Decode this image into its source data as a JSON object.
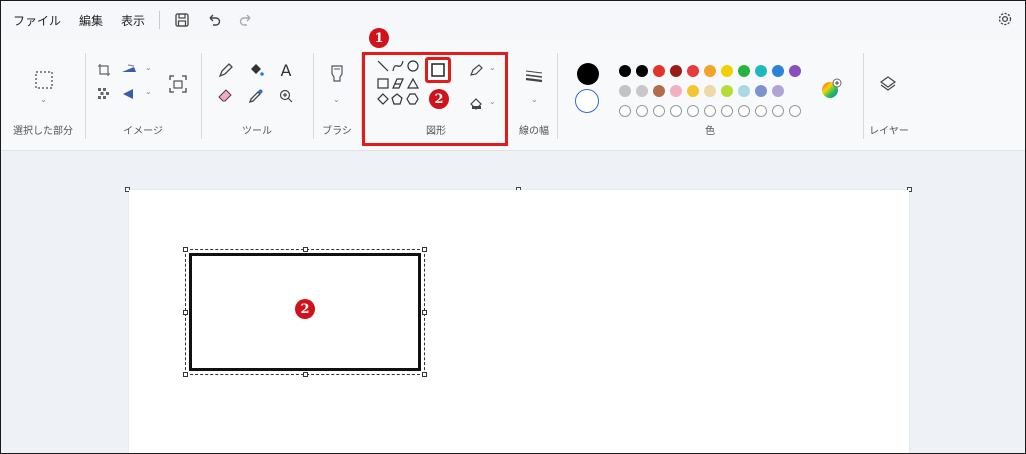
{
  "menubar": {
    "file": "ファイル",
    "edit": "編集",
    "view": "表示",
    "icons": [
      "save-icon",
      "undo-icon",
      "redo-icon",
      "settings-icon"
    ]
  },
  "ribbon": {
    "selection_label": "選択した部分",
    "image_label": "イメージ",
    "tools_label": "ツール",
    "brush_label": "ブラシ",
    "shapes_label": "図形",
    "stroke_label": "線の幅",
    "color_label": "色",
    "layers_label": "レイヤー",
    "text_tool": "A"
  },
  "annotations": {
    "badge1": "1",
    "badge2_ribbon": "2",
    "badge2_canvas": "2"
  },
  "colors": {
    "accent_red": "#e21b1b",
    "current_fill": "#000000",
    "row1": [
      "#000000",
      "#000000",
      "#e2342b",
      "#9b1c14",
      "#e8393d",
      "#f4a329",
      "#f3d100",
      "#27b33f",
      "#1fb8c0",
      "#2a83d9",
      "#8a4fbf"
    ],
    "row2": [
      "#c3c3c3",
      "#c8c8c8",
      "#b26d4a",
      "#f3b0c3",
      "#f5c52d",
      "#eed9a8",
      "#b7dc3a",
      "#a9d8e0",
      "#7c94c9",
      "#b3a3d4"
    ]
  }
}
